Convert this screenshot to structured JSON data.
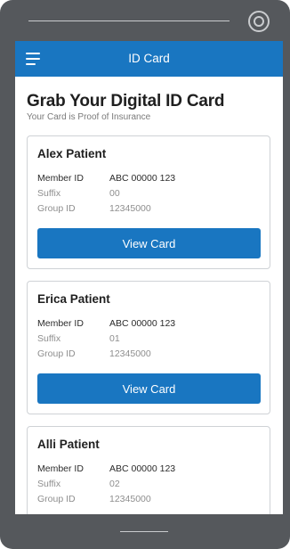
{
  "appbar": {
    "title": "ID Card",
    "menu_icon": "hamburger-menu-icon"
  },
  "page": {
    "title": "Grab Your Digital ID Card",
    "subtitle": "Your Card is Proof of Insurance"
  },
  "cards": [
    {
      "name": "Alex Patient",
      "member_id_label": "Member ID",
      "member_id": "ABC 00000 123",
      "suffix_label": "Suffix",
      "suffix": "00",
      "group_id_label": "Group ID",
      "group_id": "12345000",
      "button_label": "View Card"
    },
    {
      "name": "Erica Patient",
      "member_id_label": "Member ID",
      "member_id": "ABC 00000 123",
      "suffix_label": "Suffix",
      "suffix": "01",
      "group_id_label": "Group ID",
      "group_id": "12345000",
      "button_label": "View Card"
    },
    {
      "name": "Alli Patient",
      "member_id_label": "Member ID",
      "member_id": "ABC 00000 123",
      "suffix_label": "Suffix",
      "suffix": "02",
      "group_id_label": "Group ID",
      "group_id": "12345000"
    }
  ],
  "colors": {
    "brand": "#1976c1",
    "device_frame": "#55585c",
    "text_primary": "#1f1f1f",
    "text_muted": "#8e8e8e"
  }
}
